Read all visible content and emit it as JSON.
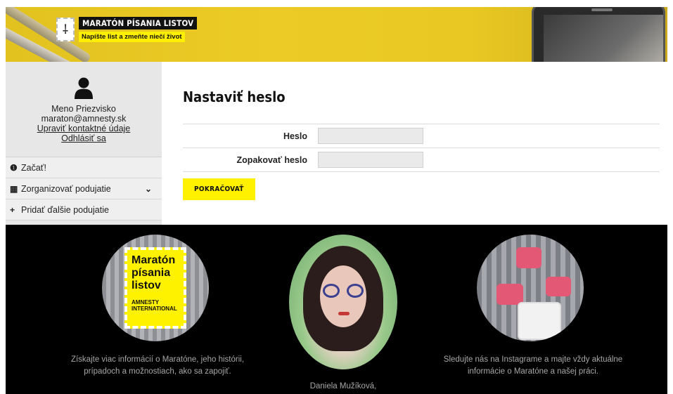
{
  "header": {
    "logo_title": "MARATÓN PÍSANIA LISTOV",
    "logo_subtitle": "Napíšte list a zmeňte niečí život"
  },
  "sidebar": {
    "user_name": "Meno Priezvisko",
    "user_email": "maraton@amnesty.sk",
    "edit_contact_link": "Upraviť kontaktné údaje",
    "logout_link": "Odhlásiť sa",
    "menu": [
      {
        "icon": "info-icon",
        "label": "Začať!"
      },
      {
        "icon": "calendar-icon",
        "label": "Zorganizovať podujatie",
        "expandable": true
      },
      {
        "icon": "plus-icon",
        "label": "Pridať ďalšie podujatie"
      }
    ]
  },
  "main": {
    "title": "Nastaviť heslo",
    "fields": [
      {
        "label": "Heslo",
        "value": "",
        "placeholder": ""
      },
      {
        "label": "Zopakovať heslo",
        "value": "",
        "placeholder": ""
      }
    ],
    "submit_label": "POKRAČOVAŤ"
  },
  "footer": {
    "stamp_title_lines": [
      "Maratón",
      "písania",
      "listov"
    ],
    "stamp_org": "AMNESTY INTERNATIONAL",
    "caption_left": "Získajte viac informácií o Maratóne, jeho histórii, prípadoch a možnostiach, ako sa zapojiť.",
    "caption_center": "Daniela Mužíková,",
    "caption_right": "Sledujte nás na Instagrame a majte vždy aktuálne informácie o Maratóne a našej práci."
  },
  "colors": {
    "brand_yellow": "#fff100",
    "header_yellow": "#e9c823",
    "footer_bg": "#000000",
    "sidebar_bg": "#e7e7e7"
  }
}
